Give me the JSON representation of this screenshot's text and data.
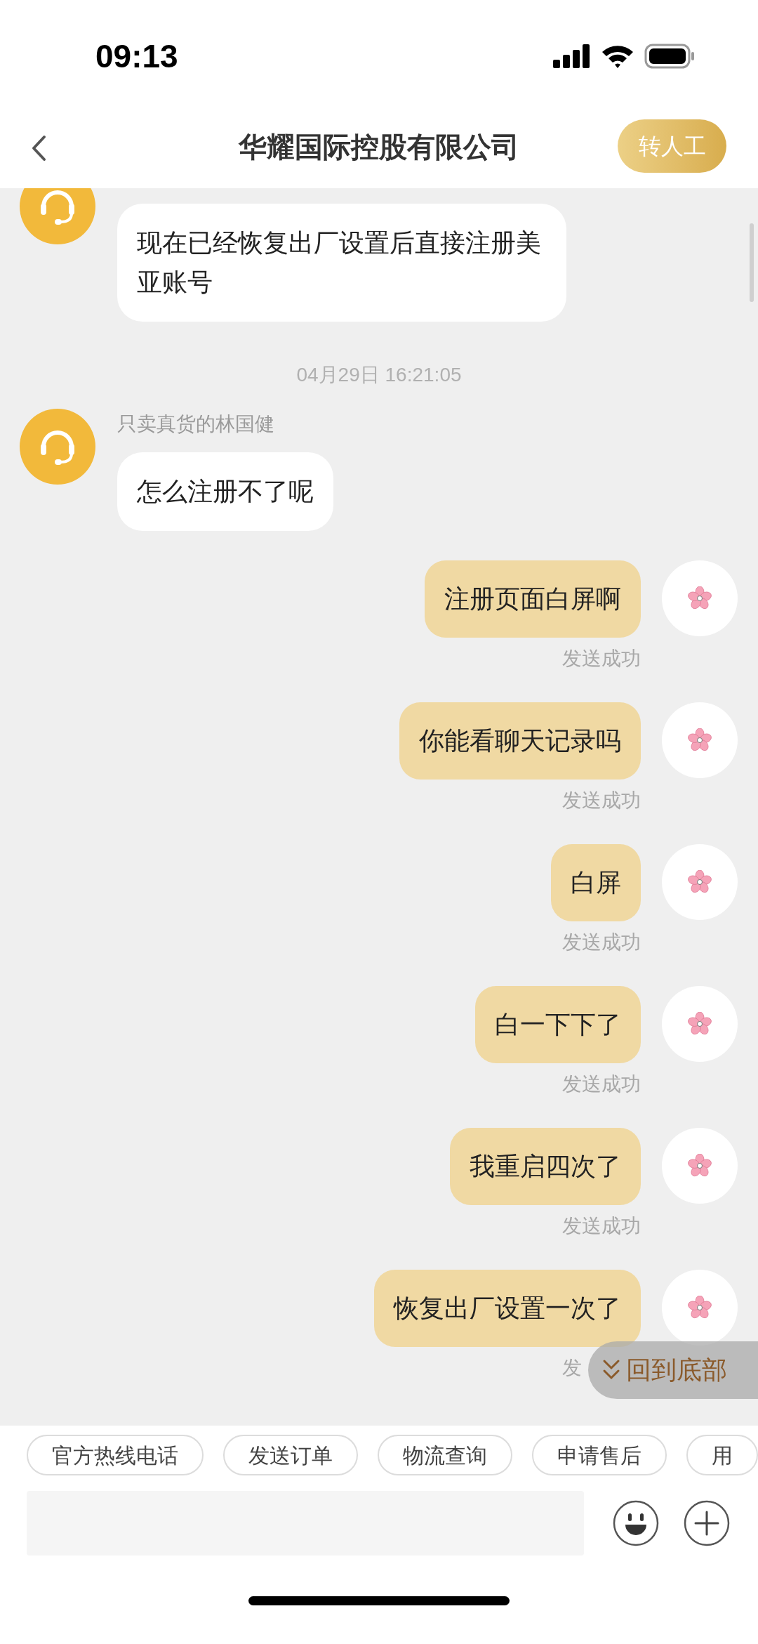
{
  "status_bar": {
    "time": "09:13"
  },
  "header": {
    "title": "华耀国际控股有限公司",
    "action": "转人工"
  },
  "messages": [
    {
      "kind": "agent",
      "text": "现在已经恢复出厂设置后直接注册美亚账号"
    },
    {
      "kind": "timestamp",
      "text": "04月29日 16:21:05"
    },
    {
      "kind": "agent",
      "sender": "只卖真货的林国健",
      "text": "怎么注册不了呢"
    },
    {
      "kind": "user",
      "text": "注册页面白屏啊",
      "status": "发送成功"
    },
    {
      "kind": "user",
      "text": "你能看聊天记录吗",
      "status": "发送成功"
    },
    {
      "kind": "user",
      "text": "白屏",
      "status": "发送成功"
    },
    {
      "kind": "user",
      "text": "白一下下了",
      "status": "发送成功"
    },
    {
      "kind": "user",
      "text": "我重启四次了",
      "status": "发送成功"
    },
    {
      "kind": "user",
      "text": "恢复出厂设置一次了",
      "status": "发"
    }
  ],
  "scroll_to_bottom": "回到底部",
  "quick_replies": [
    "官方热线电话",
    "发送订单",
    "物流查询",
    "申请售后",
    "用"
  ]
}
